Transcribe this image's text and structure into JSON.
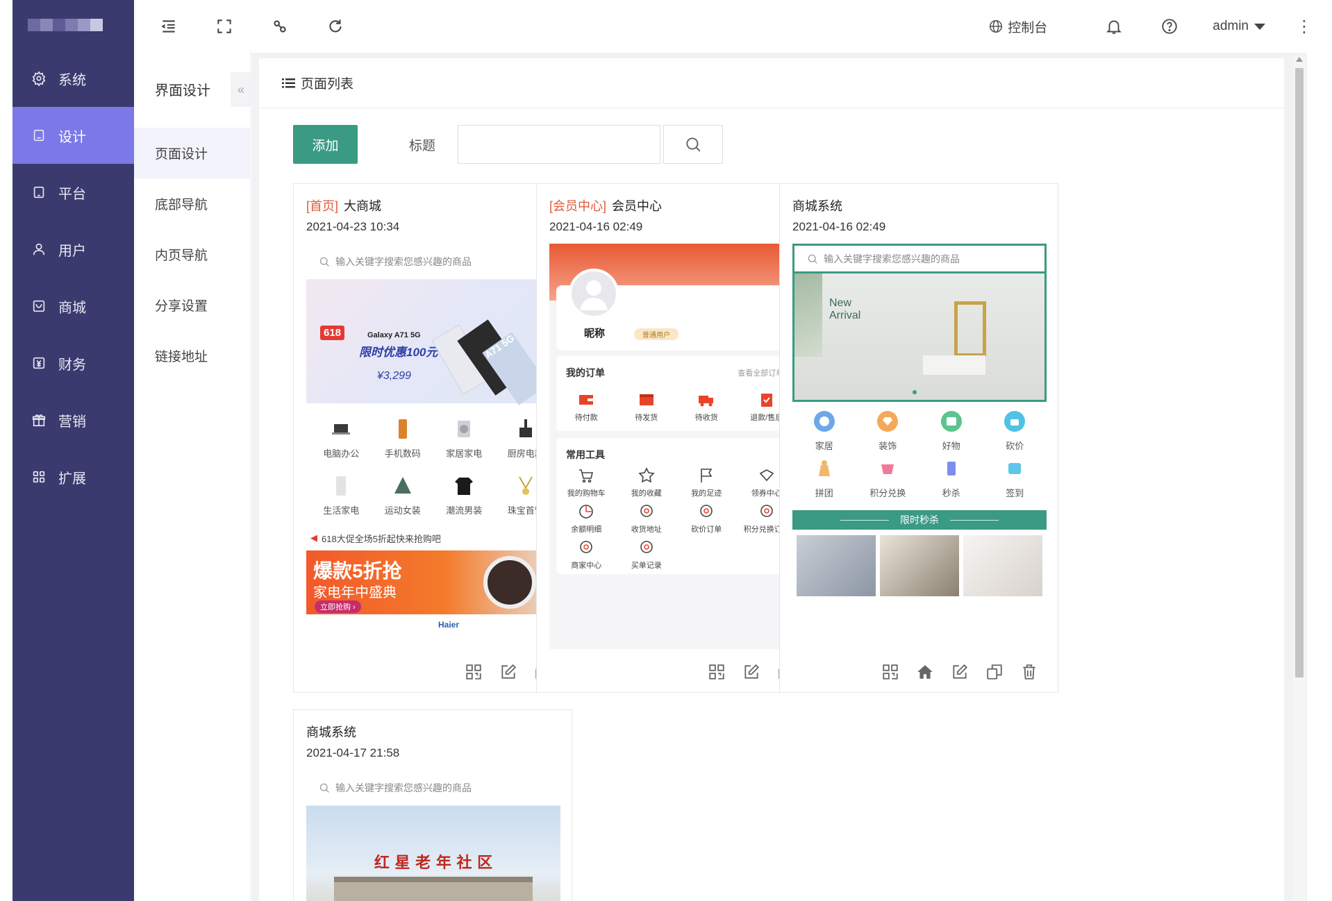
{
  "topbar": {
    "console_label": "控制台",
    "user_label": "admin"
  },
  "main_nav": [
    {
      "label": "系统",
      "icon": "gear-icon"
    },
    {
      "label": "设计",
      "icon": "design-icon"
    },
    {
      "label": "平台",
      "icon": "tablet-icon"
    },
    {
      "label": "用户",
      "icon": "user-icon"
    },
    {
      "label": "商城",
      "icon": "shop-icon"
    },
    {
      "label": "财务",
      "icon": "yen-icon"
    },
    {
      "label": "营销",
      "icon": "gift-icon"
    },
    {
      "label": "扩展",
      "icon": "grid-icon"
    }
  ],
  "sub_nav": {
    "title": "界面设计",
    "collapse_glyph": "«",
    "items": [
      "页面设计",
      "底部导航",
      "内页导航",
      "分享设置",
      "链接地址"
    ]
  },
  "panel": {
    "title": "页面列表",
    "add_label": "添加",
    "title_field_label": "标题",
    "title_field_value": ""
  },
  "cards": [
    {
      "tag": "[首页]",
      "title": "大商城",
      "date": "2021-04-23 10:34",
      "search_placeholder": "输入关键字搜索您感兴趣的商品",
      "banner": {
        "badge": "618",
        "product": "Galaxy A71 5G",
        "offer": "限时优惠100元",
        "price": "¥3,299",
        "model": "A71 5G"
      },
      "categories": [
        "电脑办公",
        "手机数码",
        "家居家电",
        "厨房电器",
        "生活家电",
        "运动女装",
        "潮流男装",
        "珠宝首饰"
      ],
      "notice": "618大促全场5折起快来抢购吧",
      "promo": {
        "line1": "爆款5折抢",
        "line2": "家电年中盛典",
        "button": "立即抢购 ›"
      },
      "brand": "Haier"
    },
    {
      "tag": "[会员中心]",
      "title": "会员中心",
      "date": "2021-04-16 02:49",
      "nickname": "昵称",
      "member_badge": "普通用户",
      "orders_title": "我的订单",
      "orders_link": "查看全部订单 ›",
      "orders": [
        "待付款",
        "待发货",
        "待收货",
        "退款/售后"
      ],
      "tools_title": "常用工具",
      "tools": [
        "我的购物车",
        "我的收藏",
        "我的足迹",
        "领券中心",
        "余额明细",
        "收货地址",
        "砍价订单",
        "积分兑换订单",
        "商家中心",
        "买单记录"
      ]
    },
    {
      "tag": "",
      "title": "商城系统",
      "date": "2021-04-16 02:49",
      "search_placeholder": "输入关键字搜索您感兴趣的商品",
      "banner": {
        "line1": "New",
        "line2": "Arrival"
      },
      "icons": [
        "家居",
        "装饰",
        "好物",
        "砍价",
        "拼团",
        "积分兑换",
        "秒杀",
        "签到"
      ],
      "flash_sale": "限时秒杀"
    },
    {
      "tag": "",
      "title": "商城系统",
      "date": "2021-04-17 21:58",
      "search_placeholder": "输入关键字搜索您感兴趣的商品",
      "banner_text": "红 星 老 年 社 区"
    }
  ],
  "colors": {
    "nav_bg": "#3b3a6e",
    "nav_active": "#7b78e8",
    "primary_green": "#3a9a83",
    "tag_red": "#e05a3a"
  }
}
